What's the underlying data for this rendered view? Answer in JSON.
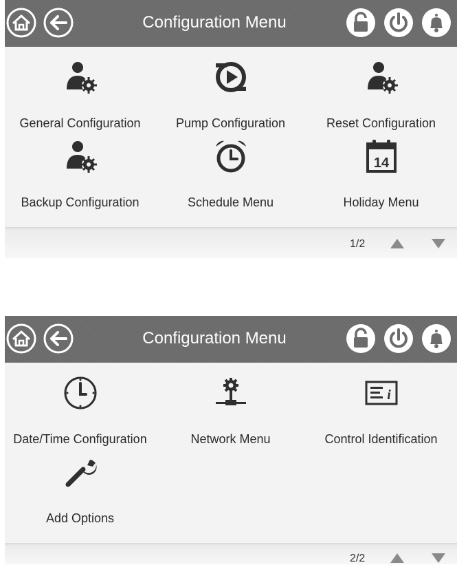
{
  "screens": [
    {
      "title": "Configuration Menu",
      "page": "1/2",
      "items": [
        {
          "label": "General Configuration",
          "icon": "user-gear-icon"
        },
        {
          "label": "Pump Configuration",
          "icon": "pump-icon"
        },
        {
          "label": "Reset Configuration",
          "icon": "user-gear-icon"
        },
        {
          "label": "Backup Configuration",
          "icon": "user-gear-icon"
        },
        {
          "label": "Schedule Menu",
          "icon": "alarm-clock-icon"
        },
        {
          "label": "Holiday Menu",
          "icon": "calendar-icon"
        }
      ]
    },
    {
      "title": "Configuration Menu",
      "page": "2/2",
      "items": [
        {
          "label": "Date/Time Configuration",
          "icon": "clock-icon"
        },
        {
          "label": "Network Menu",
          "icon": "network-icon"
        },
        {
          "label": "Control Identification",
          "icon": "info-card-icon"
        },
        {
          "label": "Add Options",
          "icon": "wrench-icon"
        }
      ]
    }
  ],
  "calendar_day": "14",
  "colors": {
    "header": "#6c6c6c",
    "icon": "#2f2f2f",
    "background": "#f2f2f2"
  }
}
